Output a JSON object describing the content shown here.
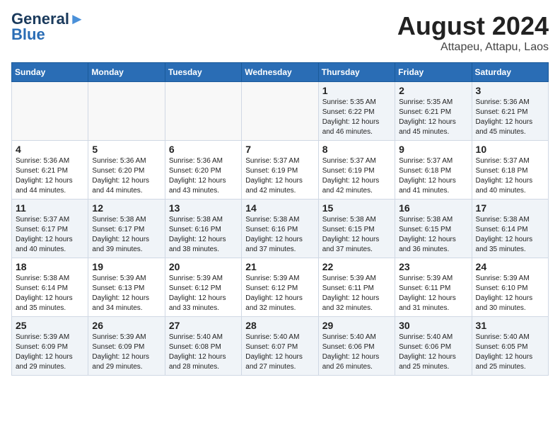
{
  "header": {
    "logo_general": "General",
    "logo_blue": "Blue",
    "month_title": "August 2024",
    "subtitle": "Attapeu, Attapu, Laos"
  },
  "days_of_week": [
    "Sunday",
    "Monday",
    "Tuesday",
    "Wednesday",
    "Thursday",
    "Friday",
    "Saturday"
  ],
  "weeks": [
    [
      {
        "day": "",
        "info": ""
      },
      {
        "day": "",
        "info": ""
      },
      {
        "day": "",
        "info": ""
      },
      {
        "day": "",
        "info": ""
      },
      {
        "day": "1",
        "info": "Sunrise: 5:35 AM\nSunset: 6:22 PM\nDaylight: 12 hours\nand 46 minutes."
      },
      {
        "day": "2",
        "info": "Sunrise: 5:35 AM\nSunset: 6:21 PM\nDaylight: 12 hours\nand 45 minutes."
      },
      {
        "day": "3",
        "info": "Sunrise: 5:36 AM\nSunset: 6:21 PM\nDaylight: 12 hours\nand 45 minutes."
      }
    ],
    [
      {
        "day": "4",
        "info": "Sunrise: 5:36 AM\nSunset: 6:21 PM\nDaylight: 12 hours\nand 44 minutes."
      },
      {
        "day": "5",
        "info": "Sunrise: 5:36 AM\nSunset: 6:20 PM\nDaylight: 12 hours\nand 44 minutes."
      },
      {
        "day": "6",
        "info": "Sunrise: 5:36 AM\nSunset: 6:20 PM\nDaylight: 12 hours\nand 43 minutes."
      },
      {
        "day": "7",
        "info": "Sunrise: 5:37 AM\nSunset: 6:19 PM\nDaylight: 12 hours\nand 42 minutes."
      },
      {
        "day": "8",
        "info": "Sunrise: 5:37 AM\nSunset: 6:19 PM\nDaylight: 12 hours\nand 42 minutes."
      },
      {
        "day": "9",
        "info": "Sunrise: 5:37 AM\nSunset: 6:18 PM\nDaylight: 12 hours\nand 41 minutes."
      },
      {
        "day": "10",
        "info": "Sunrise: 5:37 AM\nSunset: 6:18 PM\nDaylight: 12 hours\nand 40 minutes."
      }
    ],
    [
      {
        "day": "11",
        "info": "Sunrise: 5:37 AM\nSunset: 6:17 PM\nDaylight: 12 hours\nand 40 minutes."
      },
      {
        "day": "12",
        "info": "Sunrise: 5:38 AM\nSunset: 6:17 PM\nDaylight: 12 hours\nand 39 minutes."
      },
      {
        "day": "13",
        "info": "Sunrise: 5:38 AM\nSunset: 6:16 PM\nDaylight: 12 hours\nand 38 minutes."
      },
      {
        "day": "14",
        "info": "Sunrise: 5:38 AM\nSunset: 6:16 PM\nDaylight: 12 hours\nand 37 minutes."
      },
      {
        "day": "15",
        "info": "Sunrise: 5:38 AM\nSunset: 6:15 PM\nDaylight: 12 hours\nand 37 minutes."
      },
      {
        "day": "16",
        "info": "Sunrise: 5:38 AM\nSunset: 6:15 PM\nDaylight: 12 hours\nand 36 minutes."
      },
      {
        "day": "17",
        "info": "Sunrise: 5:38 AM\nSunset: 6:14 PM\nDaylight: 12 hours\nand 35 minutes."
      }
    ],
    [
      {
        "day": "18",
        "info": "Sunrise: 5:38 AM\nSunset: 6:14 PM\nDaylight: 12 hours\nand 35 minutes."
      },
      {
        "day": "19",
        "info": "Sunrise: 5:39 AM\nSunset: 6:13 PM\nDaylight: 12 hours\nand 34 minutes."
      },
      {
        "day": "20",
        "info": "Sunrise: 5:39 AM\nSunset: 6:12 PM\nDaylight: 12 hours\nand 33 minutes."
      },
      {
        "day": "21",
        "info": "Sunrise: 5:39 AM\nSunset: 6:12 PM\nDaylight: 12 hours\nand 32 minutes."
      },
      {
        "day": "22",
        "info": "Sunrise: 5:39 AM\nSunset: 6:11 PM\nDaylight: 12 hours\nand 32 minutes."
      },
      {
        "day": "23",
        "info": "Sunrise: 5:39 AM\nSunset: 6:11 PM\nDaylight: 12 hours\nand 31 minutes."
      },
      {
        "day": "24",
        "info": "Sunrise: 5:39 AM\nSunset: 6:10 PM\nDaylight: 12 hours\nand 30 minutes."
      }
    ],
    [
      {
        "day": "25",
        "info": "Sunrise: 5:39 AM\nSunset: 6:09 PM\nDaylight: 12 hours\nand 29 minutes."
      },
      {
        "day": "26",
        "info": "Sunrise: 5:39 AM\nSunset: 6:09 PM\nDaylight: 12 hours\nand 29 minutes."
      },
      {
        "day": "27",
        "info": "Sunrise: 5:40 AM\nSunset: 6:08 PM\nDaylight: 12 hours\nand 28 minutes."
      },
      {
        "day": "28",
        "info": "Sunrise: 5:40 AM\nSunset: 6:07 PM\nDaylight: 12 hours\nand 27 minutes."
      },
      {
        "day": "29",
        "info": "Sunrise: 5:40 AM\nSunset: 6:06 PM\nDaylight: 12 hours\nand 26 minutes."
      },
      {
        "day": "30",
        "info": "Sunrise: 5:40 AM\nSunset: 6:06 PM\nDaylight: 12 hours\nand 25 minutes."
      },
      {
        "day": "31",
        "info": "Sunrise: 5:40 AM\nSunset: 6:05 PM\nDaylight: 12 hours\nand 25 minutes."
      }
    ]
  ]
}
